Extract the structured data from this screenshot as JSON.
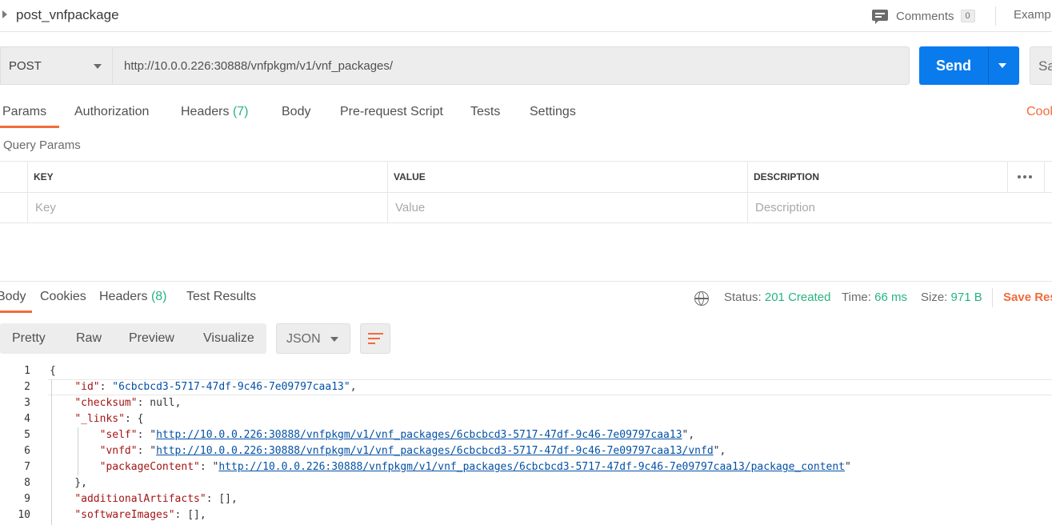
{
  "header": {
    "title": "post_vnfpackage",
    "comments_label": "Comments",
    "comments_count": "0",
    "examples_label": "Examp"
  },
  "request": {
    "method": "POST",
    "url": "http://10.0.0.226:30888/vnfpkgm/v1/vnf_packages/",
    "send_label": "Send",
    "save_label": "Sa"
  },
  "request_tabs": [
    {
      "label": "Params",
      "count": ""
    },
    {
      "label": "Authorization",
      "count": ""
    },
    {
      "label": "Headers",
      "count": "(7)"
    },
    {
      "label": "Body",
      "count": ""
    },
    {
      "label": "Pre-request Script",
      "count": ""
    },
    {
      "label": "Tests",
      "count": ""
    },
    {
      "label": "Settings",
      "count": ""
    }
  ],
  "cookies_link": "Cook",
  "query_params": {
    "label": "Query Params",
    "columns": [
      "KEY",
      "VALUE",
      "DESCRIPTION"
    ],
    "placeholders": {
      "key": "Key",
      "value": "Value",
      "description": "Description"
    }
  },
  "response_tabs": [
    {
      "label": "Body",
      "count": ""
    },
    {
      "label": "Cookies",
      "count": ""
    },
    {
      "label": "Headers",
      "count": "(8)"
    },
    {
      "label": "Test Results",
      "count": ""
    }
  ],
  "response_status": {
    "status_label": "Status:",
    "status_value": "201 Created",
    "time_label": "Time:",
    "time_value": "66 ms",
    "size_label": "Size:",
    "size_value": "971 B",
    "save_response": "Save Res"
  },
  "view_modes": [
    "Pretty",
    "Raw",
    "Preview",
    "Visualize"
  ],
  "format": "JSON",
  "code": {
    "line_numbers": [
      "1",
      "2",
      "3",
      "4",
      "5",
      "6",
      "7",
      "8",
      "9",
      "10"
    ],
    "id_key": "\"id\"",
    "id_value": "\"6cbcbcd3-5717-47df-9c46-7e09797caa13\"",
    "checksum_key": "\"checksum\"",
    "checksum_value": "null",
    "links_key": "\"_links\"",
    "self_key": "\"self\"",
    "self_url": "http://10.0.0.226:30888/vnfpkgm/v1/vnf_packages/6cbcbcd3-5717-47df-9c46-7e09797caa13",
    "vnfd_key": "\"vnfd\"",
    "vnfd_url": "http://10.0.0.226:30888/vnfpkgm/v1/vnf_packages/6cbcbcd3-5717-47df-9c46-7e09797caa13/vnfd",
    "package_content_key": "\"packageContent\"",
    "package_content_url": "http://10.0.0.226:30888/vnfpkgm/v1/vnf_packages/6cbcbcd3-5717-47df-9c46-7e09797caa13/package_content",
    "additional_artifacts_key": "\"additionalArtifacts\"",
    "software_images_key": "\"softwareImages\""
  },
  "colors": {
    "accent": "#f26b3a",
    "send_button": "#097bed",
    "success": "#26b47f"
  }
}
